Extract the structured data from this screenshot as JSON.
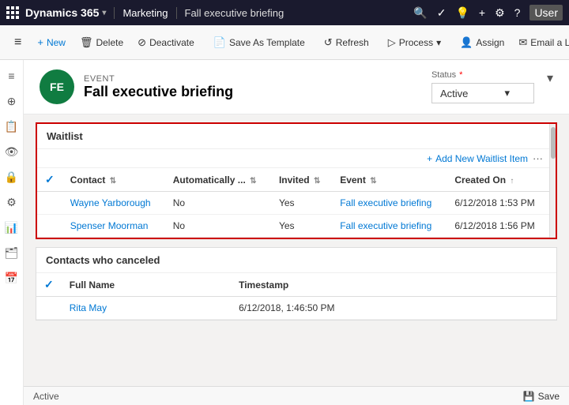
{
  "topNav": {
    "appsLabel": "Apps",
    "brand": "Dynamics 365",
    "chevron": "▾",
    "moduleName": "Marketing",
    "recordTitle": "Fall executive briefing",
    "searchPlaceholder": "Search",
    "settingsLabel": "Settings",
    "helpLabel": "Help",
    "userLabel": "User"
  },
  "toolbar": {
    "menuLabel": "≡",
    "newLabel": "New",
    "deleteLabel": "Delete",
    "deactivateLabel": "Deactivate",
    "saveAsTemplateLabel": "Save As Template",
    "refreshLabel": "Refresh",
    "processLabel": "Process",
    "assignLabel": "Assign",
    "emailLinkLabel": "Email a Link",
    "moreLabel": "..."
  },
  "record": {
    "eventType": "EVENT",
    "initials": "FE",
    "name": "Fall executive briefing",
    "statusLabel": "Status",
    "statusRequired": "*",
    "statusValue": "Active"
  },
  "waitlist": {
    "title": "Waitlist",
    "addNewLabel": "Add New Waitlist Item",
    "moreOptionsLabel": "···",
    "columns": [
      {
        "label": "Contact",
        "sortable": true
      },
      {
        "label": "Automatically ...",
        "sortable": true
      },
      {
        "label": "Invited",
        "sortable": true
      },
      {
        "label": "Event",
        "sortable": true
      },
      {
        "label": "Created On",
        "sortable": true
      }
    ],
    "rows": [
      {
        "contact": "Wayne Yarborough",
        "automatically": "No",
        "invited": "Yes",
        "event": "Fall executive briefing",
        "createdOn": "6/12/2018 1:53 PM"
      },
      {
        "contact": "Spenser Moorman",
        "automatically": "No",
        "invited": "Yes",
        "event": "Fall executive briefing",
        "createdOn": "6/12/2018 1:56 PM"
      }
    ]
  },
  "canceledContacts": {
    "title": "Contacts who canceled",
    "columns": [
      {
        "label": "Full Name",
        "sortable": false
      },
      {
        "label": "Timestamp",
        "sortable": false
      }
    ],
    "rows": [
      {
        "fullName": "Rita May",
        "timestamp": "6/12/2018, 1:46:50 PM"
      }
    ]
  },
  "statusBar": {
    "statusText": "Active",
    "saveLabel": "Save"
  },
  "sidebar": {
    "icons": [
      "≡",
      "⊕",
      "📋",
      "👁",
      "🔒",
      "⚙",
      "📊",
      "🗂",
      "📅"
    ]
  }
}
